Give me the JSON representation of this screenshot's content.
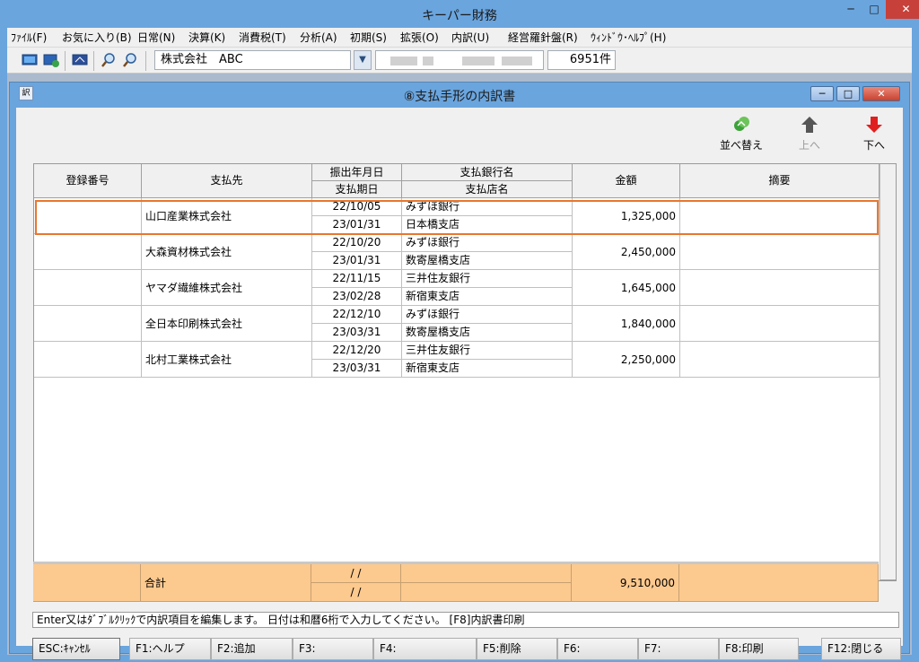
{
  "window": {
    "title": "キーパー財務",
    "min_label": "─",
    "max_label": "□",
    "close_label": "✕"
  },
  "menu": [
    "ﾌｧｲﾙ(F)",
    "お気に入り(B)",
    "日常(N)",
    "決算(K)",
    "消費税(T)",
    "分析(A)",
    "初期(S)",
    "拡張(O)",
    "内訳(U)",
    "経営羅針盤(R)",
    "ｳｨﾝﾄﾞｳ･ﾍﾙﾌﾟ(H)"
  ],
  "toolbar": {
    "company": "株式会社　ABC",
    "count": "6951件"
  },
  "child": {
    "title": "⑧支払手形の内訳書",
    "icon_label": "訳"
  },
  "actions": {
    "sort": "並べ替え",
    "up": "上へ",
    "down": "下へ"
  },
  "grid": {
    "headers": {
      "reg_no": "登録番号",
      "payee": "支払先",
      "issue_date": "振出年月日",
      "due_date": "支払期日",
      "bank": "支払銀行名",
      "branch": "支払店名",
      "amount": "金額",
      "memo": "摘要"
    },
    "rows": [
      {
        "payee": "山口産業株式会社",
        "issue": "22/10/05",
        "due": "23/01/31",
        "bank": "みずほ銀行",
        "branch": "日本橋支店",
        "amount": "1,325,000"
      },
      {
        "payee": "大森資材株式会社",
        "issue": "22/10/20",
        "due": "23/01/31",
        "bank": "みずほ銀行",
        "branch": "数寄屋橋支店",
        "amount": "2,450,000"
      },
      {
        "payee": "ヤマダ繊維株式会社",
        "issue": "22/11/15",
        "due": "23/02/28",
        "bank": "三井住友銀行",
        "branch": "新宿東支店",
        "amount": "1,645,000"
      },
      {
        "payee": "全日本印刷株式会社",
        "issue": "22/12/10",
        "due": "23/03/31",
        "bank": "みずほ銀行",
        "branch": "数寄屋橋支店",
        "amount": "1,840,000"
      },
      {
        "payee": "北村工業株式会社",
        "issue": "22/12/20",
        "due": "23/03/31",
        "bank": "三井住友銀行",
        "branch": "新宿東支店",
        "amount": "2,250,000"
      }
    ]
  },
  "total": {
    "label": "合計",
    "date1": "/ /",
    "date2": "/ /",
    "amount": "9,510,000"
  },
  "status": "Enter又はﾀﾞﾌﾞﾙｸﾘｯｸで内訳項目を編集します。 日付は和暦6桁で入力してください。 [F8]内訳書印刷",
  "fkeys": [
    "ESC:ｷｬﾝｾﾙ",
    "F1:ヘルプ",
    "F2:追加",
    "F3:",
    "F4:",
    "F5:削除",
    "F6:",
    "F7:",
    "F8:印刷",
    "F12:閉じる"
  ],
  "colors": {
    "accent": "#6aa5de",
    "selection": "#e8772e",
    "total_bg": "#fcc98f"
  }
}
